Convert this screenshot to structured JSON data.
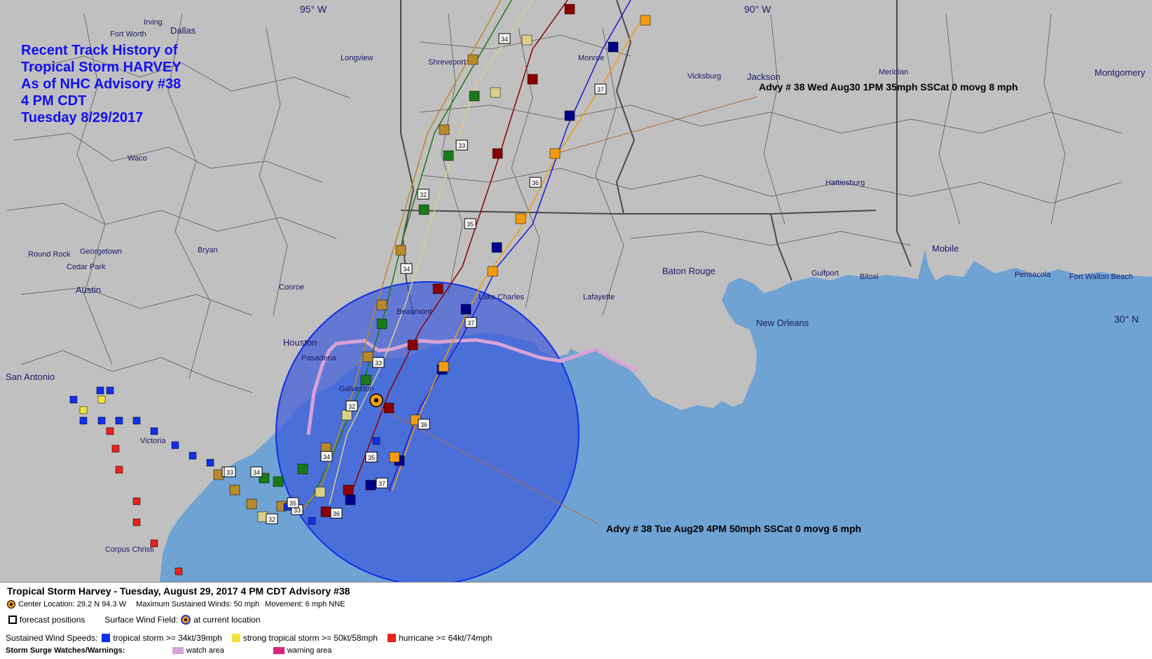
{
  "map": {
    "heading": [
      "Recent Track History of",
      "Tropical Storm HARVEY",
      "As of NHC Advisory #38",
      "4 PM CDT",
      "Tuesday 8/29/2017"
    ],
    "meridians": [
      "95° W",
      "90° W"
    ],
    "latitude_label": "30° N",
    "cities": [
      "Irving",
      "Fort Worth",
      "Dallas",
      "Longview",
      "Shreveport",
      "Monroe",
      "Vicksburg",
      "Jackson",
      "Meridian",
      "Montgomery",
      "Waco",
      "Hattiesburg",
      "Round Rock",
      "Georgetown",
      "Bryan",
      "Cedar Park",
      "Austin",
      "Conroe",
      "Mobile",
      "Baton Rouge",
      "Gulfport",
      "Biloxi",
      "Pensacola",
      "Fort Walton Beach",
      "Beaumont",
      "Lake Charles",
      "Lafayette",
      "Houston",
      "Pasadena",
      "Galveston",
      "New Orleans",
      "San Antonio",
      "Victoria",
      "Corpus Christi"
    ],
    "callout_forecast": "Advy # 38 Wed Aug30 1PM  35mph SSCat 0 movg 8 mph",
    "callout_current": "Advy # 38 Tue Aug29 4PM  50mph SSCat 0 movg 6 mph",
    "colors": {
      "land": "#c0c0c0",
      "water": "#6fa3d4",
      "wind_field": "#3d5bd9",
      "tropical_storm": "#1130e8",
      "strong_tropical_storm": "#f2e33a",
      "hurricane": "#e8231d",
      "watch_area": "#d7a2d6",
      "warning_area": "#d9267e",
      "heading_text": "#1010f0"
    }
  },
  "legend": {
    "title": "Tropical Storm Harvey  -  Tuesday, August 29, 2017  4 PM CDT   Advisory #38",
    "center_location_label": "Center Location: 29.2 N   94.3 W",
    "max_winds_label": "Maximum Sustained Winds: 50 mph",
    "movement_label": "Movement: 6 mph NNE",
    "forecast_positions": "forecast positions",
    "surface_wind_field": "Surface Wind Field:",
    "at_current_location": "at current location",
    "sustained_wind_speeds": "Sustained Wind Speeds:",
    "tropical_storm": "tropical storm >= 34kt/39mph",
    "strong_tropical_storm": "strong tropical storm >= 50kt/58mph",
    "hurricane": "hurricane >= 64kt/74mph",
    "storm_surge": "Storm Surge Watches/Warnings:",
    "watch_area": "watch area",
    "warning_area": "warning area"
  }
}
